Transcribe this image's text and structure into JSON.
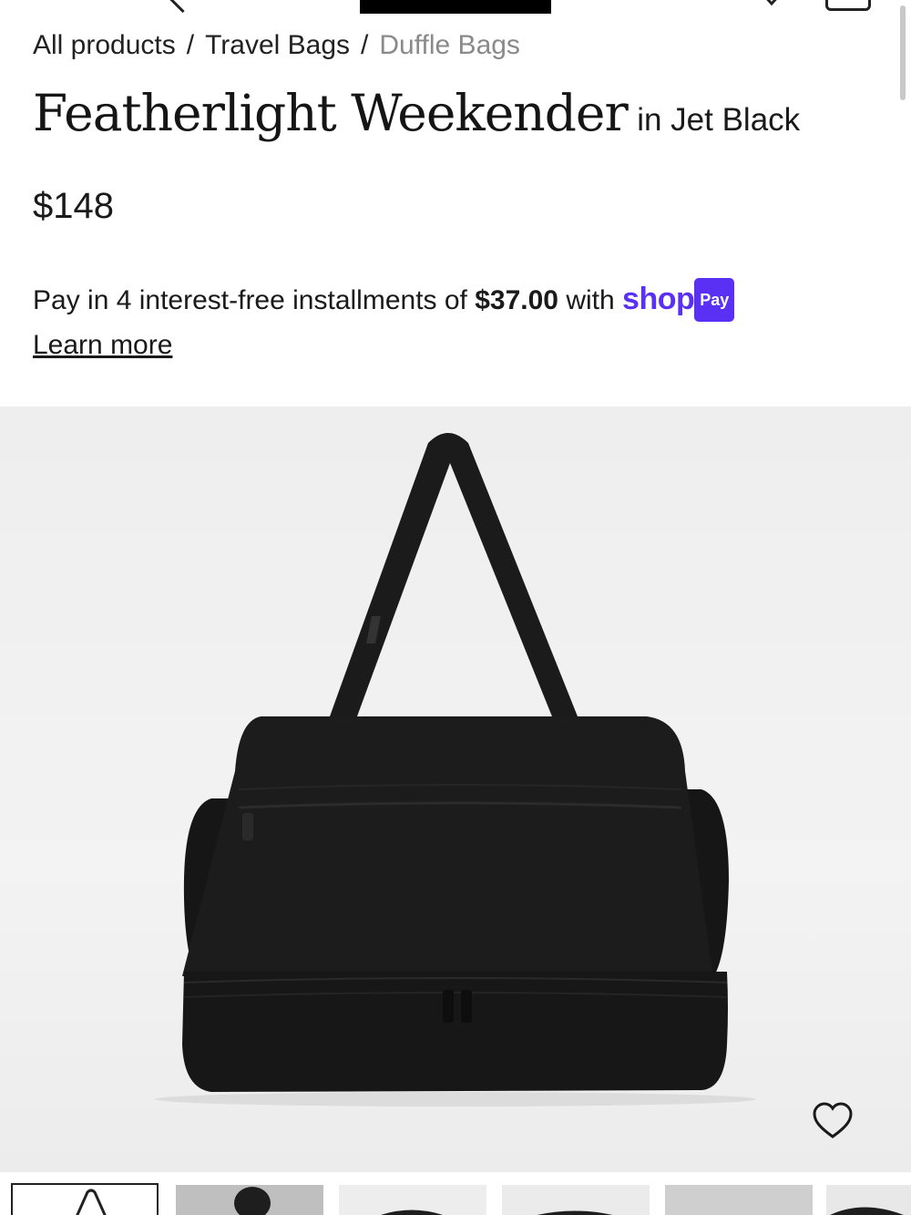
{
  "nav": {
    "icons": [
      "back-chevron-icon",
      "brand-logo",
      "heart-icon",
      "shopping-bag-icon"
    ]
  },
  "breadcrumb": {
    "items": [
      "All products",
      "Travel Bags",
      "Duffle Bags"
    ],
    "separator": "/"
  },
  "product": {
    "title": "Featherlight Weekender",
    "color_suffix": "in Jet Black",
    "price": "$148"
  },
  "installments": {
    "prefix": "Pay in 4 interest-free installments of",
    "amount": "$37.00",
    "with": "with",
    "shop_logo": "shop",
    "pay_badge": "Pay",
    "learn_more": "Learn more"
  },
  "colors": {
    "shop_purple": "#5a31f4",
    "text": "#1a1a1a",
    "hero_bg": "#eeeeee"
  },
  "thumbnails": {
    "count_visible": 6,
    "active_index": 0
  }
}
